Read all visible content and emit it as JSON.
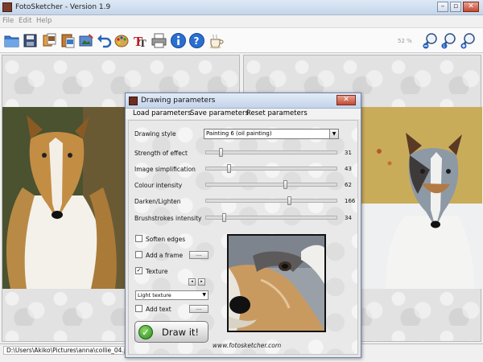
{
  "window": {
    "title": "FotoSketcher - Version 1.9",
    "controls": {
      "minimize": "–",
      "restore": "▫",
      "close": "✕"
    }
  },
  "menubar": {
    "items": [
      "File",
      "Edit",
      "Help"
    ]
  },
  "toolbar": {
    "zoom_level": "52 %",
    "icons": [
      "open-folder-icon",
      "save-icon",
      "copy-icon",
      "paste-icon",
      "process-icon",
      "undo-icon",
      "palette-icon",
      "text-icon",
      "print-icon",
      "info-icon",
      "help-icon",
      "coffee-icon",
      "zoom-out-icon",
      "zoom-fit-icon",
      "zoom-in-icon"
    ]
  },
  "statusbar": {
    "path": "D:\\Users\\Akiko\\Pictures\\anna\\collie_04.jpg"
  },
  "dialog": {
    "title": "Drawing parameters",
    "menu": [
      "Load parameters",
      "Save parameters",
      "Reset parameters"
    ],
    "drawing_style_label": "Drawing style",
    "drawing_style_value": "Painting 6 (oil painting)",
    "sliders": [
      {
        "label": "Strength of effect",
        "value": "31",
        "fraction": 0.1
      },
      {
        "label": "Image simplification",
        "value": "43",
        "fraction": 0.17
      },
      {
        "label": "Colour intensity",
        "value": "62",
        "fraction": 0.62
      },
      {
        "label": "Darken/Lighten",
        "value": "166",
        "fraction": 0.65
      },
      {
        "label": "Brushstrokes intensity",
        "value": "34",
        "fraction": 0.13
      }
    ],
    "options": {
      "soften_edges": {
        "label": "Soften edges",
        "checked": false
      },
      "add_frame": {
        "label": "Add a frame",
        "checked": false,
        "button": "...."
      },
      "texture": {
        "label": "Texture",
        "checked": true,
        "prev": "◂",
        "next": "▸"
      },
      "texture_value": "Light texture",
      "add_text": {
        "label": "Add text",
        "checked": false,
        "button": "...."
      }
    },
    "draw_button": "Draw it!",
    "website": "www.fotosketcher.com"
  }
}
